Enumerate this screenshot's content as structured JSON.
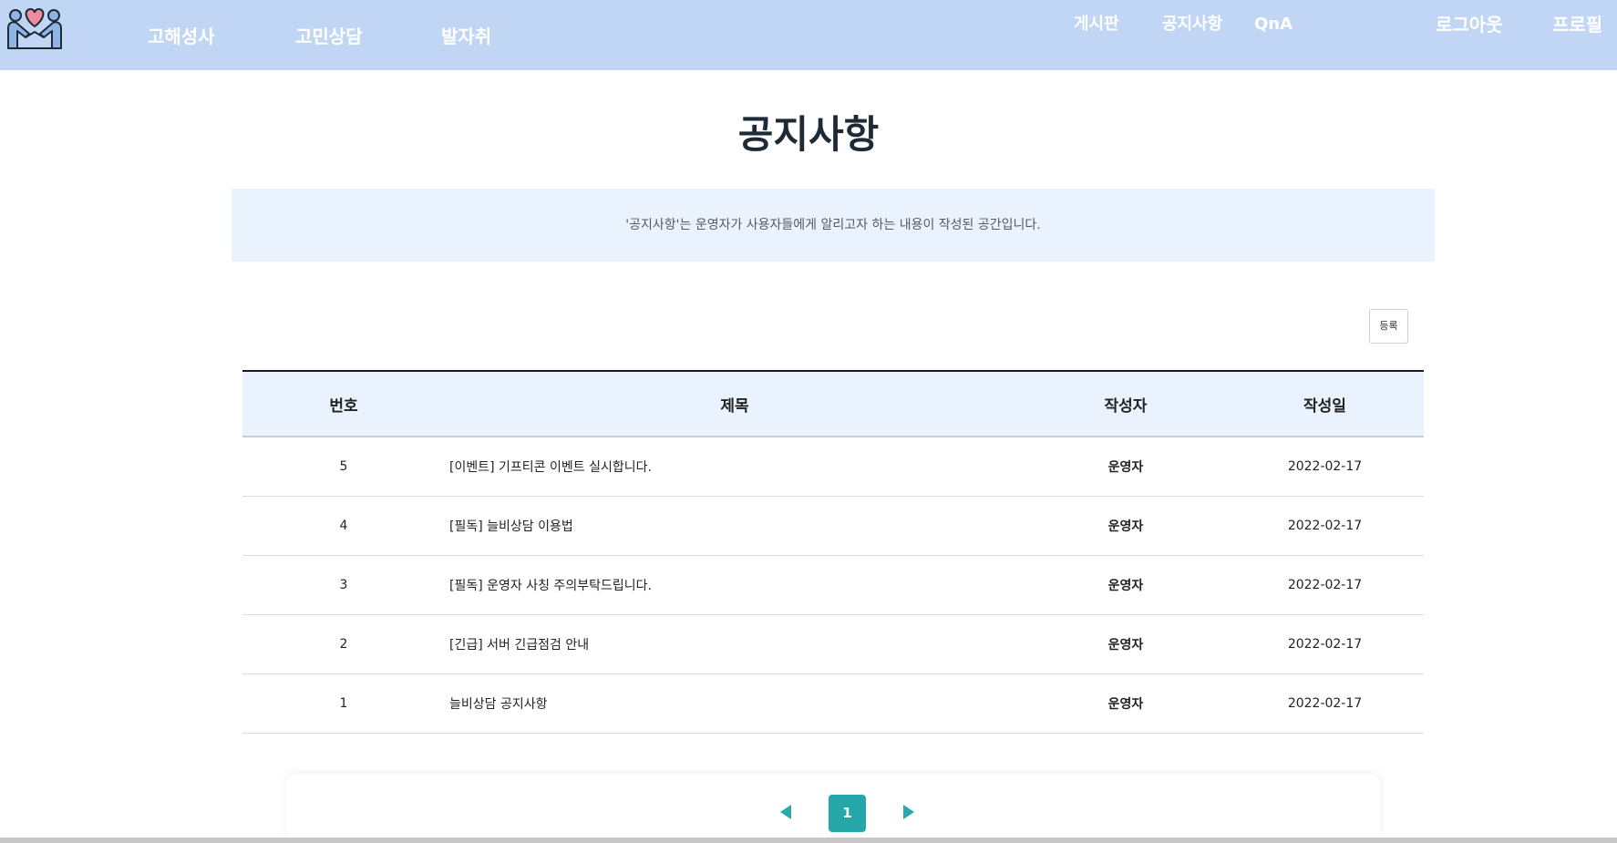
{
  "nav": {
    "left_links": [
      "고해성사",
      "고민상담",
      "발자취"
    ],
    "center_links": [
      "게시판",
      "공지사항",
      "QnA"
    ],
    "logout": "로그아웃",
    "profile": "프로필"
  },
  "page": {
    "title": "공지사항",
    "description": "'공지사항'는 운영자가 사용자들에게 알리고자 하는 내용이 작성된 공간입니다.",
    "write_button": "등록"
  },
  "table": {
    "headers": [
      "번호",
      "제목",
      "작성자",
      "작성일"
    ],
    "rows": [
      {
        "num": "5",
        "title": "[이벤트] 기프티콘 이벤트 실시합니다.",
        "writer": "운영자",
        "date": "2022-02-17"
      },
      {
        "num": "4",
        "title": "[필독] 늘비상담 이용법",
        "writer": "운영자",
        "date": "2022-02-17"
      },
      {
        "num": "3",
        "title": "[필독] 운영자 사칭 주의부탁드립니다.",
        "writer": "운영자",
        "date": "2022-02-17"
      },
      {
        "num": "2",
        "title": "[긴급] 서버 긴급점검 안내",
        "writer": "운영자",
        "date": "2022-02-17"
      },
      {
        "num": "1",
        "title": "늘비상담 공지사항",
        "writer": "운영자",
        "date": "2022-02-17"
      }
    ]
  },
  "pagination": {
    "current_page": "1",
    "prev_icon": "triangle-left-icon",
    "next_icon": "triangle-right-icon"
  },
  "colors": {
    "nav_background": "#c1d6f5",
    "banner_background": "#eaf2fd",
    "accent": "#25a7a9",
    "logo_heart": "#f08aa0",
    "logo_body": "#8fb4e6"
  }
}
